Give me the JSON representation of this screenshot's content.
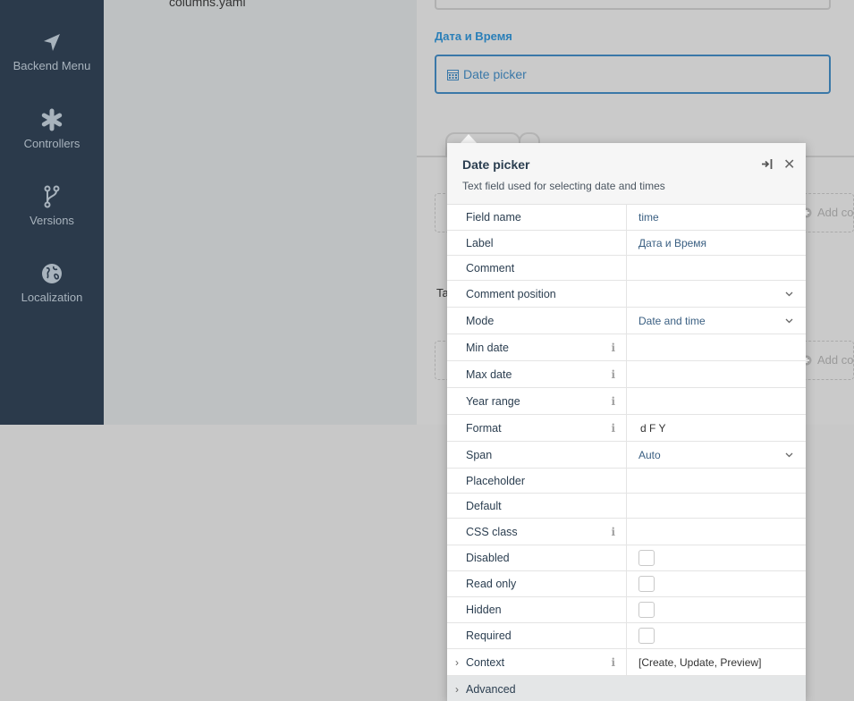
{
  "sidebar": {
    "items": [
      {
        "label": "Backend Menu",
        "icon": "navigation-arrow-icon"
      },
      {
        "label": "Controllers",
        "icon": "asterisk-icon"
      },
      {
        "label": "Versions",
        "icon": "branch-icon"
      },
      {
        "label": "Localization",
        "icon": "globe-icon"
      }
    ]
  },
  "middle": {
    "file_name": "columns.yaml"
  },
  "form": {
    "field_label": "Дата и Время",
    "date_picker_text": "Date picker",
    "add_text_1": "Add co",
    "add_text_2": "Add co",
    "tab_text": "Ta"
  },
  "popover": {
    "title": "Date picker",
    "description": "Text field used for selecting date and times",
    "rows": [
      {
        "label": "Field name",
        "value": "time"
      },
      {
        "label": "Label",
        "value": "Дата и Время"
      },
      {
        "label": "Comment",
        "value": ""
      },
      {
        "label": "Comment position",
        "value": ""
      },
      {
        "label": "Mode",
        "value": "Date and time"
      },
      {
        "label": "Min date",
        "value": ""
      },
      {
        "label": "Max date",
        "value": ""
      },
      {
        "label": "Year range",
        "value": ""
      },
      {
        "label": "Format",
        "value": "d F Y"
      },
      {
        "label": "Span",
        "value": "Auto"
      },
      {
        "label": "Placeholder",
        "value": ""
      },
      {
        "label": "Default",
        "value": ""
      },
      {
        "label": "CSS class",
        "value": ""
      },
      {
        "label": "Disabled",
        "value": ""
      },
      {
        "label": "Read only",
        "value": ""
      },
      {
        "label": "Hidden",
        "value": ""
      },
      {
        "label": "Required",
        "value": ""
      },
      {
        "label": "Context",
        "value": "[Create, Update, Preview]"
      },
      {
        "label": "Advanced",
        "value": ""
      }
    ]
  },
  "colors": {
    "sidebar_bg": "#2b3a4b",
    "accent_blue": "#3a78a8"
  }
}
